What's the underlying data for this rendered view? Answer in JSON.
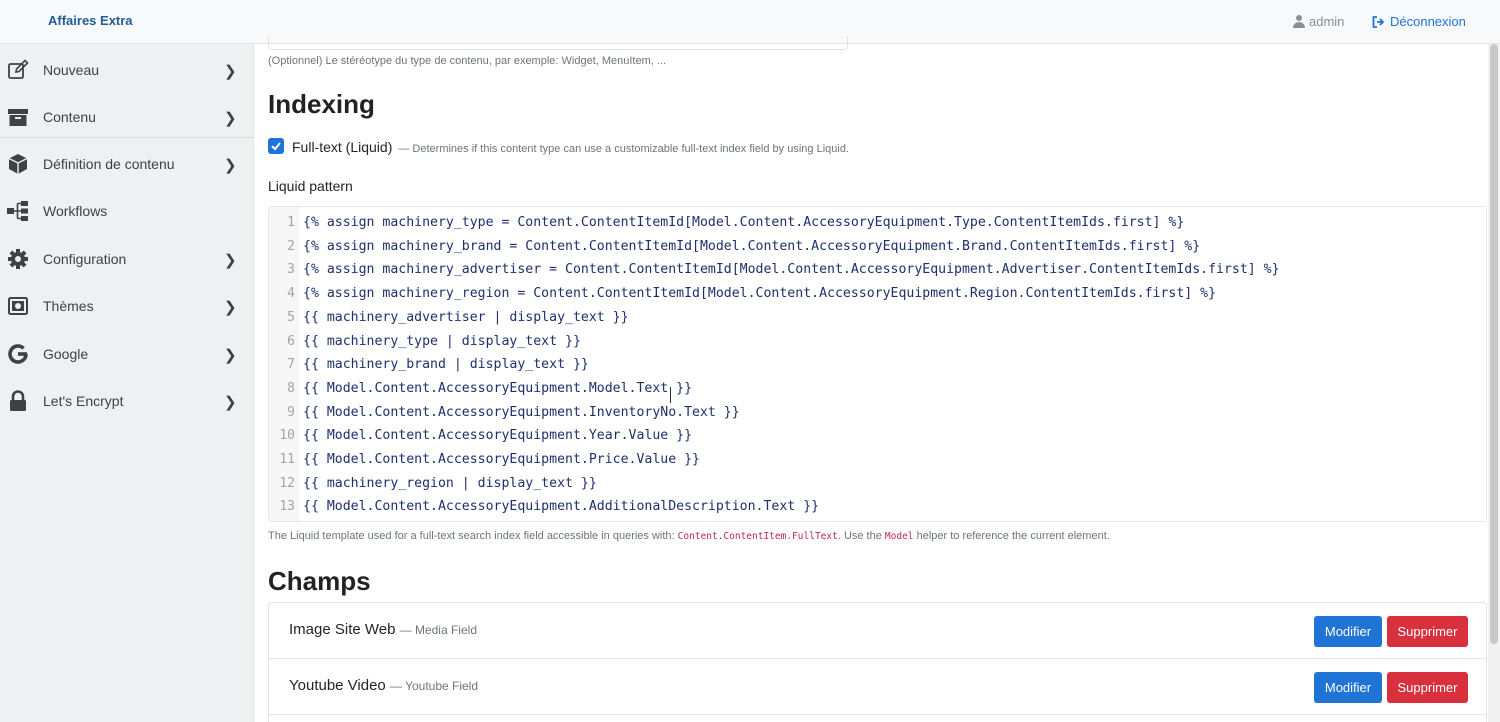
{
  "navbar": {
    "brand": "Affaires Extra",
    "user": "admin",
    "logout": "Déconnexion"
  },
  "sidebar": {
    "items": [
      {
        "label": "Nouveau",
        "icon": "edit-icon",
        "has_submenu": true
      },
      {
        "label": "Contenu",
        "icon": "archive-icon",
        "has_submenu": true
      },
      {
        "label": "Définition de contenu",
        "icon": "cube-icon",
        "has_submenu": true
      },
      {
        "label": "Workflows",
        "icon": "sitemap-icon",
        "has_submenu": false
      },
      {
        "label": "Configuration",
        "icon": "gear-icon",
        "has_submenu": true
      },
      {
        "label": "Thèmes",
        "icon": "image-icon",
        "has_submenu": true
      },
      {
        "label": "Google",
        "icon": "google-icon",
        "has_submenu": true
      },
      {
        "label": "Let's Encrypt",
        "icon": "lock-icon",
        "has_submenu": true
      }
    ]
  },
  "main": {
    "stereotype_hint": "(Optionnel) Le stéréotype du type de contenu, par exemple: Widget, MenuItem, ...",
    "indexing_title": "Indexing",
    "fulltext": {
      "checked": true,
      "label": "Full-text (Liquid)",
      "description": "— Determines if this content type can use a customizable full-text index field by using Liquid."
    },
    "liquid_pattern_label": "Liquid pattern",
    "code_lines": [
      "{% assign machinery_type = Content.ContentItemId[Model.Content.AccessoryEquipment.Type.ContentItemIds.first] %}",
      "{% assign machinery_brand = Content.ContentItemId[Model.Content.AccessoryEquipment.Brand.ContentItemIds.first] %}",
      "{% assign machinery_advertiser = Content.ContentItemId[Model.Content.AccessoryEquipment.Advertiser.ContentItemIds.first] %}",
      "{% assign machinery_region = Content.ContentItemId[Model.Content.AccessoryEquipment.Region.ContentItemIds.first] %}",
      "{{ machinery_advertiser | display_text }}",
      "{{ machinery_type | display_text }}",
      "{{ machinery_brand | display_text }}",
      "{{ Model.Content.AccessoryEquipment.Model.Text }}",
      "{{ Model.Content.AccessoryEquipment.InventoryNo.Text }}",
      "{{ Model.Content.AccessoryEquipment.Year.Value }}",
      "{{ Model.Content.AccessoryEquipment.Price.Value }}",
      "{{ machinery_region | display_text }}",
      "{{ Model.Content.AccessoryEquipment.AdditionalDescription.Text }}"
    ],
    "pattern_hint_prefix": "The Liquid template used for a full-text search index field accessible in queries with:",
    "pattern_hint_code1": "Content.ContentItem.FullText",
    "pattern_hint_middle": ". Use the",
    "pattern_hint_code2": "Model",
    "pattern_hint_suffix": "helper to reference the current element.",
    "champs_title": "Champs",
    "fields": [
      {
        "name": "Image Site Web",
        "type": "— Media Field"
      },
      {
        "name": "Youtube Video",
        "type": "— Youtube Field"
      }
    ],
    "edit_label": "Modifier",
    "delete_label": "Supprimer"
  },
  "colors": {
    "primary": "#1f74d6",
    "danger": "#d9303e",
    "brand": "#1f5d99"
  }
}
